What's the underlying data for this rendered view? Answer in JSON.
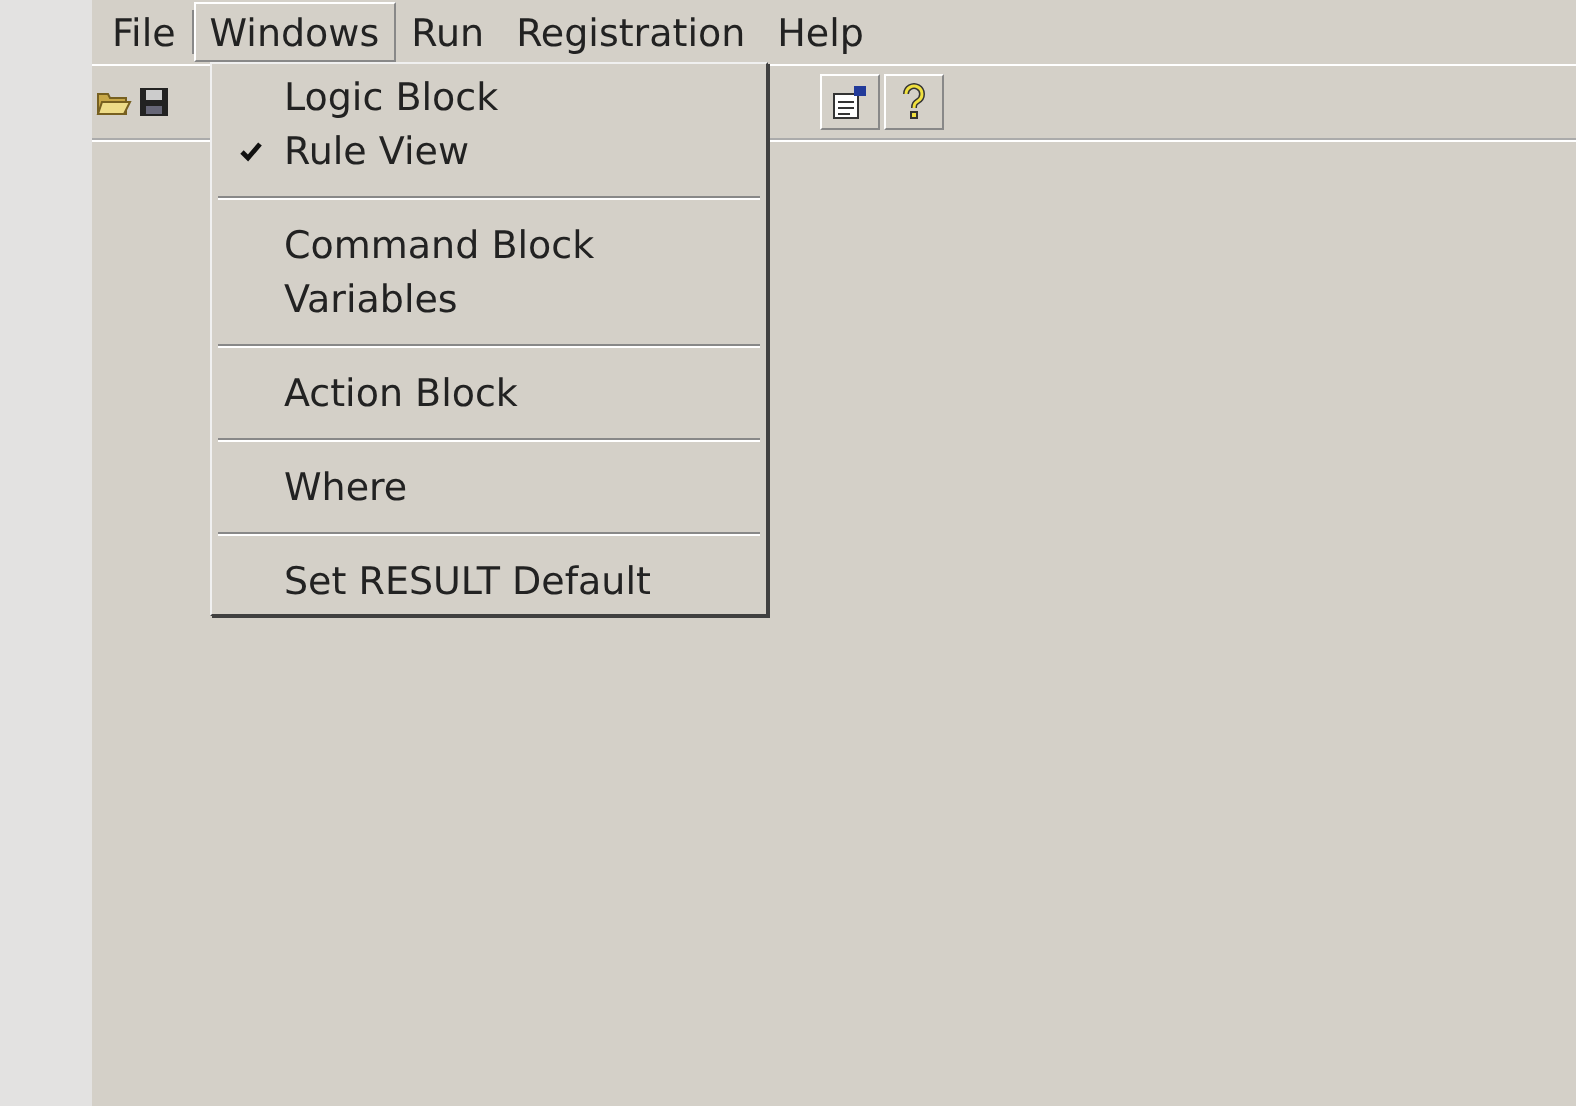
{
  "menu_bar": [
    {
      "label": "File",
      "selected": false
    },
    {
      "label": "Windows",
      "selected": true
    },
    {
      "label": "Run",
      "selected": false
    },
    {
      "label": "Registration",
      "selected": false
    },
    {
      "label": "Help",
      "selected": false
    }
  ],
  "dropdown": [
    {
      "kind": "item",
      "label": "Logic Block",
      "checked": false
    },
    {
      "kind": "item",
      "label": "Rule View",
      "checked": true
    },
    {
      "kind": "separator"
    },
    {
      "kind": "item",
      "label": "Command Block",
      "checked": false
    },
    {
      "kind": "item",
      "label": "Variables",
      "checked": false
    },
    {
      "kind": "separator"
    },
    {
      "kind": "item",
      "label": "Action Block",
      "checked": false
    },
    {
      "kind": "separator"
    },
    {
      "kind": "item",
      "label": "Where",
      "checked": false
    },
    {
      "kind": "separator"
    },
    {
      "kind": "item",
      "label": "Set RESULT Default",
      "checked": false
    }
  ]
}
